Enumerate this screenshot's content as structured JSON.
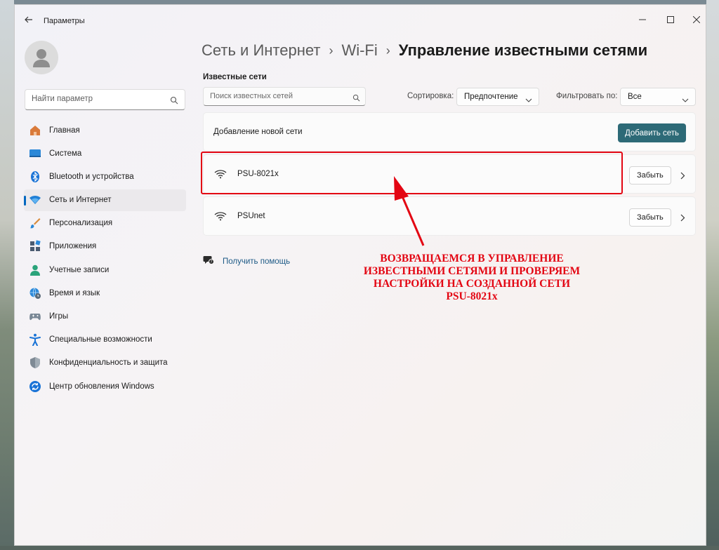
{
  "window": {
    "title": "Параметры"
  },
  "sidebar": {
    "search_placeholder": "Найти параметр",
    "items": [
      {
        "label": "Главная",
        "icon": "home-icon"
      },
      {
        "label": "Система",
        "icon": "display-icon"
      },
      {
        "label": "Bluetooth и устройства",
        "icon": "bluetooth-icon"
      },
      {
        "label": "Сеть и Интернет",
        "icon": "network-icon",
        "active": true
      },
      {
        "label": "Персонализация",
        "icon": "brush-icon"
      },
      {
        "label": "Приложения",
        "icon": "apps-icon"
      },
      {
        "label": "Учетные записи",
        "icon": "person-icon"
      },
      {
        "label": "Время и язык",
        "icon": "globe-clock-icon"
      },
      {
        "label": "Игры",
        "icon": "gamepad-icon"
      },
      {
        "label": "Специальные возможности",
        "icon": "accessibility-icon"
      },
      {
        "label": "Конфиденциальность и защита",
        "icon": "shield-icon"
      },
      {
        "label": "Центр обновления Windows",
        "icon": "update-icon"
      }
    ]
  },
  "breadcrumb": {
    "level1": "Сеть и Интернет",
    "level2": "Wi-Fi",
    "current": "Управление известными сетями"
  },
  "known_networks": {
    "section_label": "Известные сети",
    "search_placeholder": "Поиск известных сетей",
    "sort_label": "Сортировка:",
    "sort_value": "Предпочтение",
    "filter_label": "Фильтровать по:",
    "filter_value": "Все",
    "add_network_text": "Добавление новой сети",
    "add_network_button": "Добавить сеть",
    "networks": [
      {
        "name": "PSU-8021x",
        "forget_label": "Забыть"
      },
      {
        "name": "PSUnet",
        "forget_label": "Забыть"
      }
    ]
  },
  "help": {
    "label": "Получить помощь"
  },
  "annotation": {
    "line1": "ВОЗВРАЩАЕМСЯ В  УПРАВЛЕНИЕ",
    "line2": "ИЗВЕСТНЫМИ СЕТЯМИ И ПРОВЕРЯЕМ",
    "line3": "НАСТРОЙКИ НА СОЗДАННОЙ СЕТИ",
    "line4": "PSU-8021x",
    "color": "#e30613"
  },
  "colors": {
    "accent": "#0067c0",
    "primary_button": "#2d6a77",
    "link": "#1d5a86"
  }
}
